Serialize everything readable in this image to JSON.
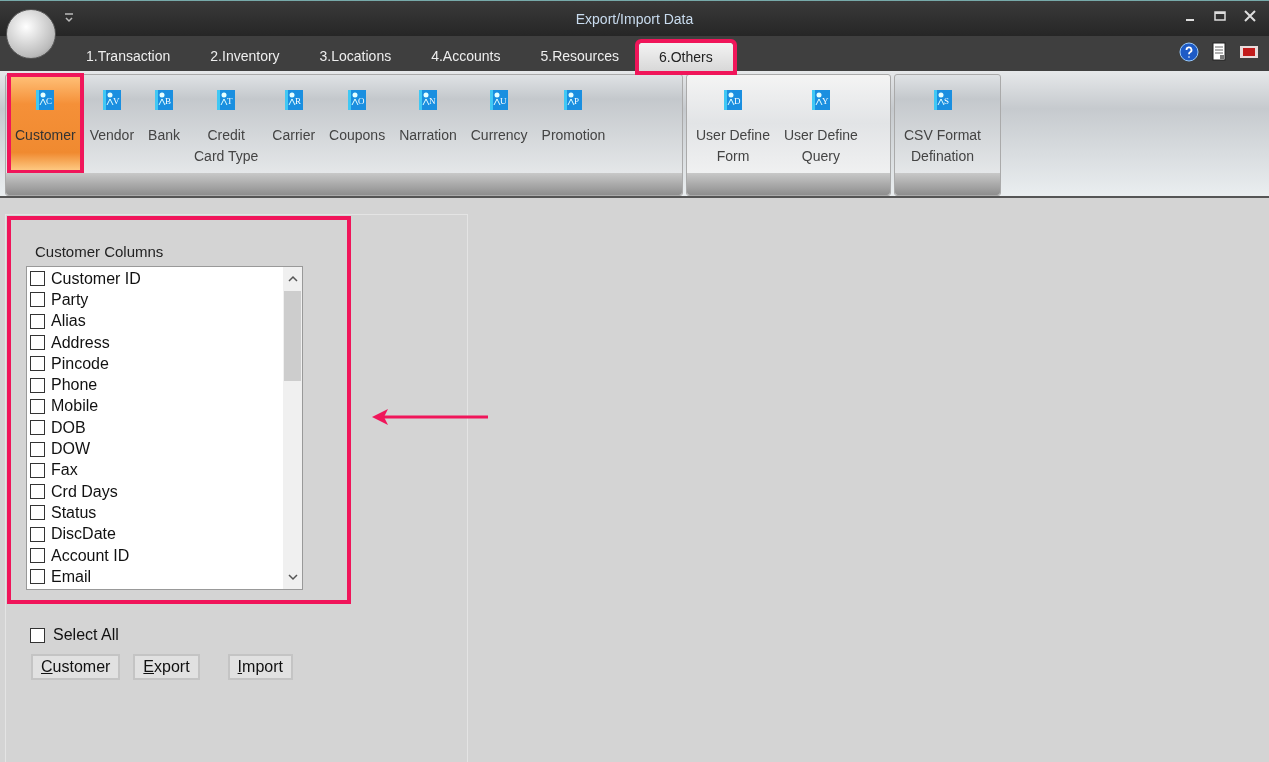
{
  "window": {
    "title": "Export/Import Data"
  },
  "tabs": [
    {
      "label": "1.Transaction",
      "selected": false,
      "highlighted": false
    },
    {
      "label": "2.Inventory",
      "selected": false,
      "highlighted": false
    },
    {
      "label": "3.Locations",
      "selected": false,
      "highlighted": false
    },
    {
      "label": "4.Accounts",
      "selected": false,
      "highlighted": false
    },
    {
      "label": "5.Resources",
      "selected": false,
      "highlighted": false
    },
    {
      "label": "6.Others",
      "selected": true,
      "highlighted": true
    }
  ],
  "ribbon_groups": [
    {
      "items": [
        {
          "label_lines": [
            "Customer"
          ],
          "glyph": "C",
          "selected": true,
          "highlighted": true
        },
        {
          "label_lines": [
            "Vendor"
          ],
          "glyph": "V",
          "selected": false,
          "highlighted": false
        },
        {
          "label_lines": [
            "Bank"
          ],
          "glyph": "B",
          "selected": false,
          "highlighted": false
        },
        {
          "label_lines": [
            "Credit",
            "Card Type"
          ],
          "glyph": "T",
          "selected": false,
          "highlighted": false
        },
        {
          "label_lines": [
            "Carrier"
          ],
          "glyph": "R",
          "selected": false,
          "highlighted": false
        },
        {
          "label_lines": [
            "Coupons"
          ],
          "glyph": "O",
          "selected": false,
          "highlighted": false
        },
        {
          "label_lines": [
            "Narration"
          ],
          "glyph": "N",
          "selected": false,
          "highlighted": false
        },
        {
          "label_lines": [
            "Currency"
          ],
          "glyph": "U",
          "selected": false,
          "highlighted": false
        },
        {
          "label_lines": [
            "Promotion"
          ],
          "glyph": "P",
          "selected": false,
          "highlighted": false
        }
      ]
    },
    {
      "items": [
        {
          "label_lines": [
            "User Define",
            "Form"
          ],
          "glyph": "D",
          "selected": false,
          "highlighted": false
        },
        {
          "label_lines": [
            "User Define",
            "Query"
          ],
          "glyph": "Y",
          "selected": false,
          "highlighted": false
        }
      ]
    },
    {
      "items": [
        {
          "label_lines": [
            "CSV Format",
            "Defination"
          ],
          "glyph": "S",
          "selected": false,
          "highlighted": false
        }
      ]
    }
  ],
  "columns_panel": {
    "title": "Customer Columns",
    "highlighted": true,
    "arrow": true,
    "items": [
      {
        "label": "Customer ID",
        "checked": false
      },
      {
        "label": "Party",
        "checked": false
      },
      {
        "label": "Alias",
        "checked": false
      },
      {
        "label": "Address",
        "checked": false
      },
      {
        "label": "Pincode",
        "checked": false
      },
      {
        "label": "Phone",
        "checked": false
      },
      {
        "label": "Mobile",
        "checked": false
      },
      {
        "label": "DOB",
        "checked": false
      },
      {
        "label": "DOW",
        "checked": false
      },
      {
        "label": "Fax",
        "checked": false
      },
      {
        "label": "Crd Days",
        "checked": false
      },
      {
        "label": "Status",
        "checked": false
      },
      {
        "label": "DiscDate",
        "checked": false
      },
      {
        "label": "Account ID",
        "checked": false
      },
      {
        "label": "Email",
        "checked": false
      }
    ]
  },
  "select_all": {
    "label": "Select All",
    "checked": false
  },
  "buttons": [
    {
      "label": "Customer",
      "mnemonic": true
    },
    {
      "label": "Export",
      "mnemonic": true
    },
    {
      "label": "Import",
      "mnemonic": true
    }
  ]
}
